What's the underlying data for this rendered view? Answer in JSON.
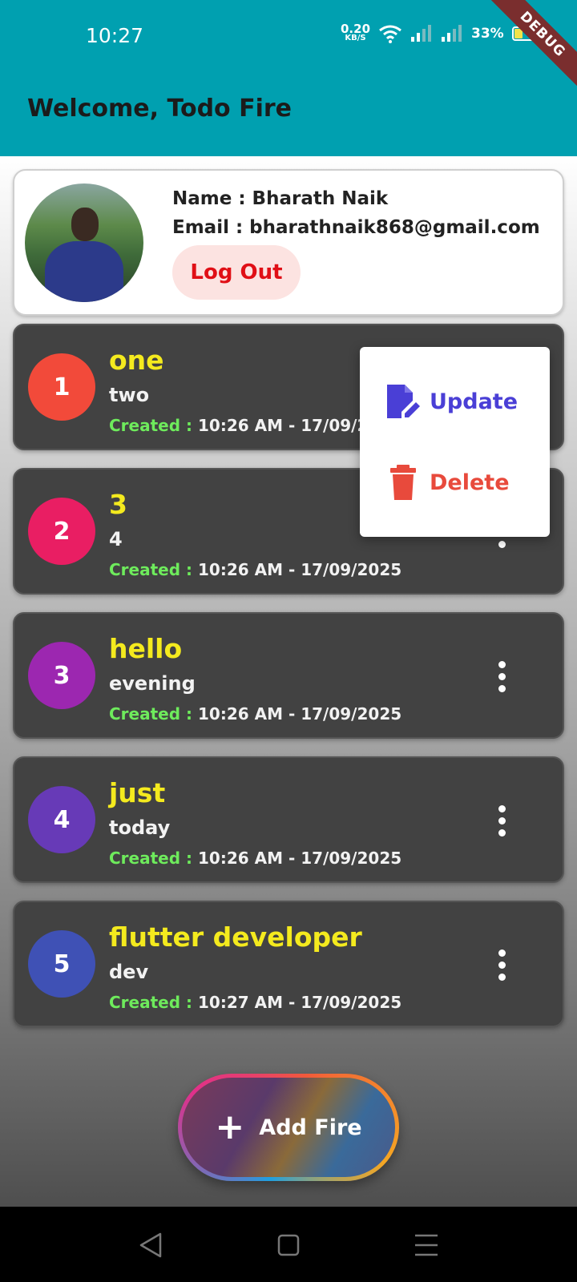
{
  "status_bar": {
    "time": "10:27",
    "speed_value": "0.20",
    "speed_unit": "KB/S",
    "battery": "33%",
    "debug_banner": "DEBUG"
  },
  "app_bar": {
    "title": "Welcome, Todo Fire",
    "color": "#00A0B0"
  },
  "profile": {
    "name": "Name : Bharath Naik",
    "email": "Email : bharathnaik868@gmail.com",
    "logout_label": "Log Out"
  },
  "todos": [
    {
      "number": "1",
      "title": "one",
      "description": "two",
      "created_label": "Created :",
      "created_value": "10:26 AM - 17/09/2025",
      "color": "#F24A3A"
    },
    {
      "number": "2",
      "title": "3",
      "description": "4",
      "created_label": "Created :",
      "created_value": "10:26 AM - 17/09/2025",
      "color": "#E91E63"
    },
    {
      "number": "3",
      "title": "hello",
      "description": "evening",
      "created_label": "Created :",
      "created_value": "10:26 AM - 17/09/2025",
      "color": "#9C27B0"
    },
    {
      "number": "4",
      "title": "just",
      "description": "today",
      "created_label": "Created :",
      "created_value": "10:26 AM - 17/09/2025",
      "color": "#673AB7"
    },
    {
      "number": "5",
      "title": "flutter developer",
      "description": "dev",
      "created_label": "Created :",
      "created_value": "10:27 AM - 17/09/2025",
      "color": "#3F51B5"
    }
  ],
  "popup_menu": {
    "update_label": "Update",
    "delete_label": "Delete"
  },
  "fab": {
    "icon": "+",
    "label": "Add Fire"
  },
  "icons": {
    "wifi": "wifi-icon",
    "signal": "signal-icon",
    "battery": "battery-icon",
    "more": "more-vertical-icon",
    "update": "edit-document-icon",
    "delete": "trash-icon",
    "back": "back-triangle-icon",
    "home": "home-square-icon",
    "recents": "menu-lines-icon"
  }
}
